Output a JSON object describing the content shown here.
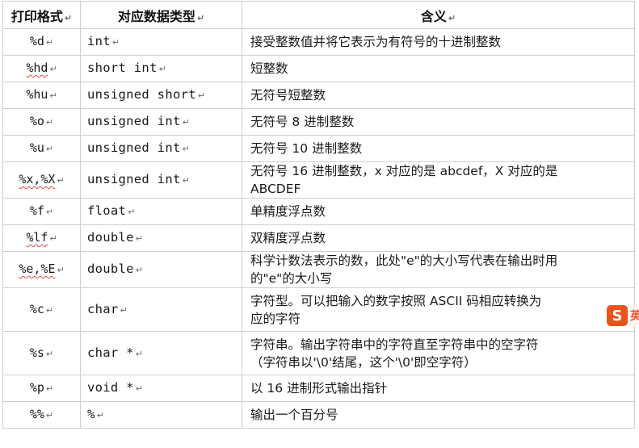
{
  "table": {
    "headers": [
      "打印格式",
      "对应数据类型",
      "含义"
    ],
    "rows": [
      {
        "format": "%d",
        "type": "int",
        "meaning": [
          "接受整数值并将它表示为有符号的十进制整数"
        ]
      },
      {
        "format": "%hd",
        "type": "short int",
        "meaning": [
          "短整数"
        ]
      },
      {
        "format": "%hu",
        "type": "unsigned short",
        "meaning": [
          "无符号短整数"
        ]
      },
      {
        "format": "%o",
        "type": "unsigned int",
        "meaning": [
          "无符号 8 进制整数"
        ]
      },
      {
        "format": "%u",
        "type": "unsigned int",
        "meaning": [
          "无符号 10 进制整数"
        ]
      },
      {
        "format": "%x,%X",
        "type": "unsigned int",
        "meaning": [
          "无符号 16 进制整数，x 对应的是 abcdef，X 对应的是",
          "ABCDEF"
        ]
      },
      {
        "format": "%f",
        "type": "float",
        "meaning": [
          "单精度浮点数"
        ]
      },
      {
        "format": "%lf",
        "type": "double",
        "meaning": [
          "双精度浮点数"
        ]
      },
      {
        "format": "%e,%E",
        "type": "double",
        "meaning": [
          "科学计数法表示的数，此处\"e\"的大小写代表在输出时用",
          "的\"e\"的大小写"
        ]
      },
      {
        "format": "%c",
        "type": "char",
        "meaning": [
          "字符型。可以把输入的数字按照 ASCII 码相应转换为",
          "应的字符"
        ]
      },
      {
        "format": "%s",
        "type": "char *",
        "meaning": [
          "字符串。输出字符串中的字符直至字符串中的空字符",
          "（字符串以'\\0'结尾，这个'\\0'即空字符）"
        ]
      },
      {
        "format": "%p",
        "type": "void *",
        "meaning": [
          "以 16 进制形式输出指针"
        ]
      },
      {
        "format": "%%",
        "type": "%",
        "meaning": [
          "输出一个百分号"
        ]
      }
    ]
  },
  "overlay": {
    "logo_letter": "S",
    "logo_text": "英",
    "icon": "sogou-ime-icon"
  }
}
